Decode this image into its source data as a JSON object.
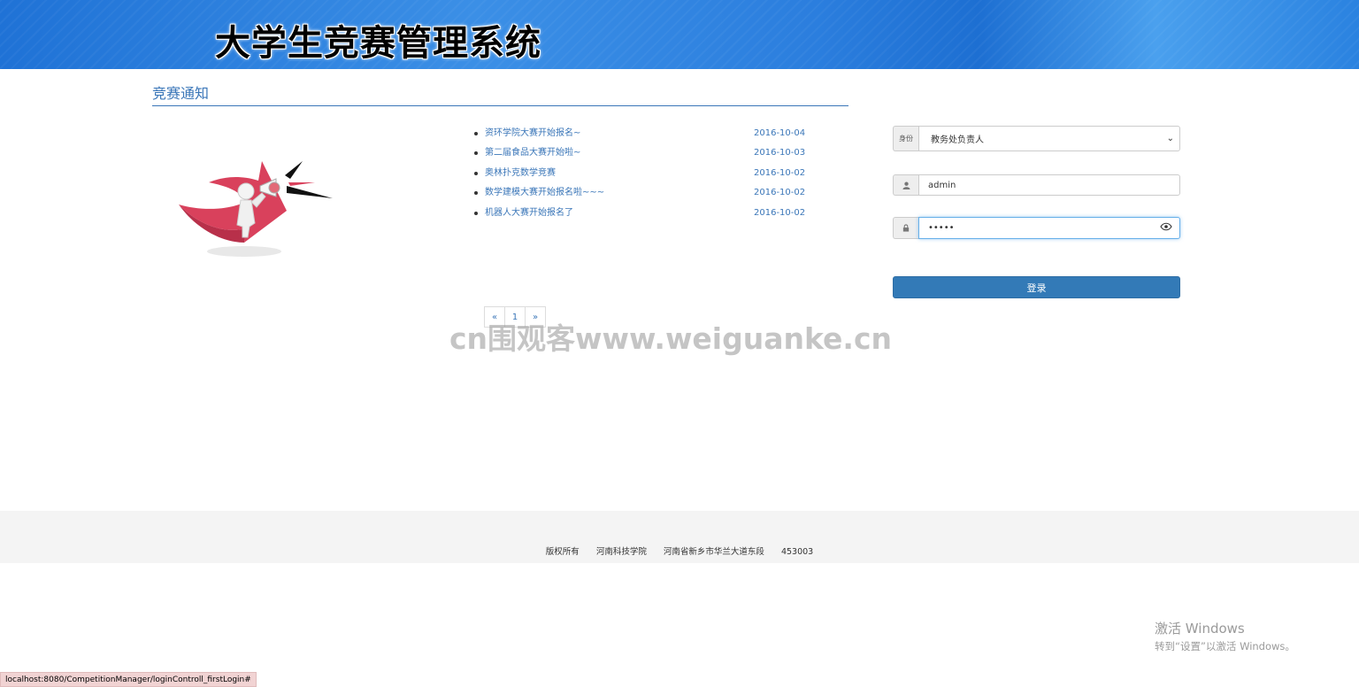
{
  "header": {
    "title": "大学生竞赛管理系统"
  },
  "section": {
    "title": "竞赛通知"
  },
  "notices": [
    {
      "title": "资环学院大赛开始报名~",
      "date": "2016-10-04"
    },
    {
      "title": "第二届食品大赛开始啦~",
      "date": "2016-10-03"
    },
    {
      "title": "奥林扑克数学竞赛",
      "date": "2016-10-02"
    },
    {
      "title": "数学建模大赛开始报名啦~~~",
      "date": "2016-10-02"
    },
    {
      "title": "机器人大赛开始报名了",
      "date": "2016-10-02"
    }
  ],
  "pagination": {
    "prev": "«",
    "current": "1",
    "next": "»"
  },
  "watermark": "cn围观客www.weiguanke.cn",
  "login": {
    "role_label": "身份",
    "role_value": "教务处负责人",
    "username_value": "admin",
    "password_mask": "•••••",
    "submit_label": "登录"
  },
  "footer": {
    "copyright": "版权所有",
    "school": "河南科技学院",
    "address": "河南省新乡市华兰大道东段",
    "postcode": "453003"
  },
  "windows_activation": {
    "line1": "激活 Windows",
    "line2": "转到“设置”以激活 Windows。"
  },
  "statusbar": {
    "url": "localhost:8080/CompetitionManager/loginControll_firstLogin#"
  }
}
